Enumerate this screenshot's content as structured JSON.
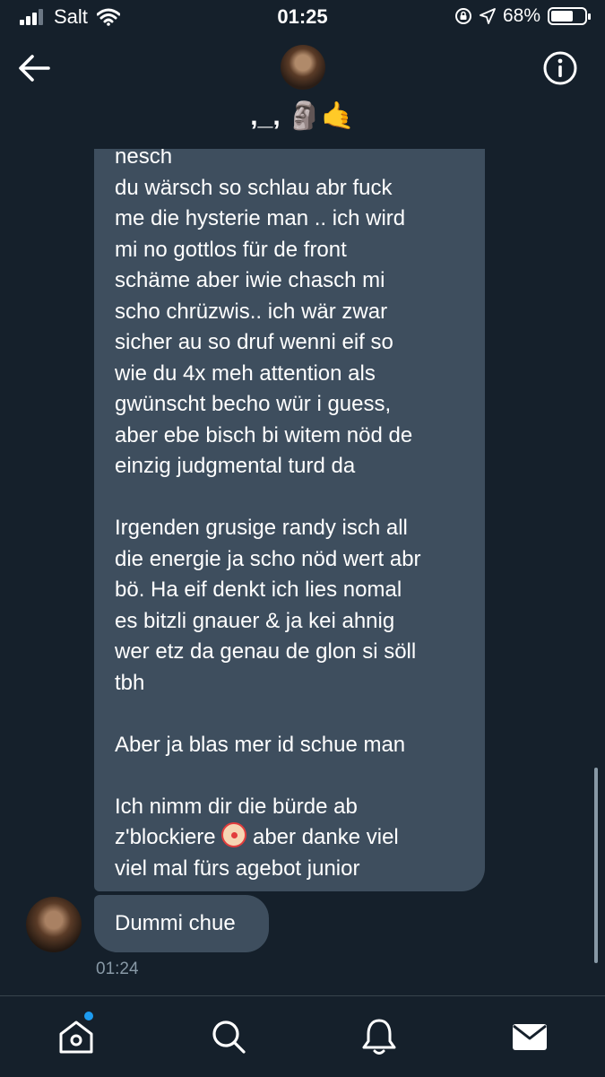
{
  "status_bar": {
    "carrier": "Salt",
    "time": "01:25",
    "battery": "68%",
    "battery_level": 0.68
  },
  "header": {
    "title": ",_, 🗿🤙",
    "icons": [
      "back-arrow-icon",
      "info-icon",
      "avatar"
    ]
  },
  "messages": [
    {
      "text": "nesch\ndu wärsch so schlau abr fuck\nme die hysterie man .. ich wird\nmi no gottlos für de front\nschäme aber iwie chasch mi\nscho chrüzwis.. ich wär zwar\nsicher au so druf wenni eif so\nwie du 4x meh attention als\ngwünscht becho wür i guess,\naber ebe bisch bi witem nöd de\neinzig judgmental turd da\n\nIrgenden grusige randy isch all\ndie energie ja scho nöd wert abr\nbö. Ha eif denkt ich lies nomal\nes bitzli gnauer & ja kei ahnig\nwer etz da genau de glon si söll\ntbh\n\nAber ja blas mer id schue man\n\nIch nimm dir die bürde ab",
      "line_clown_before": "z'blockiere",
      "line_clown_after": "aber danke viel",
      "last_line": "viel mal fürs agebot junior"
    },
    {
      "text": "Dummi chue",
      "time": "01:24"
    }
  ],
  "tabbar": {
    "tabs": [
      "home-icon",
      "search-icon",
      "notifications-icon",
      "messages-icon"
    ],
    "home_has_notification_dot": true
  },
  "colors": {
    "background": "#15202b",
    "bubble": "#3e4e5e",
    "accent": "#1d9bf0",
    "muted": "#8899a6"
  }
}
